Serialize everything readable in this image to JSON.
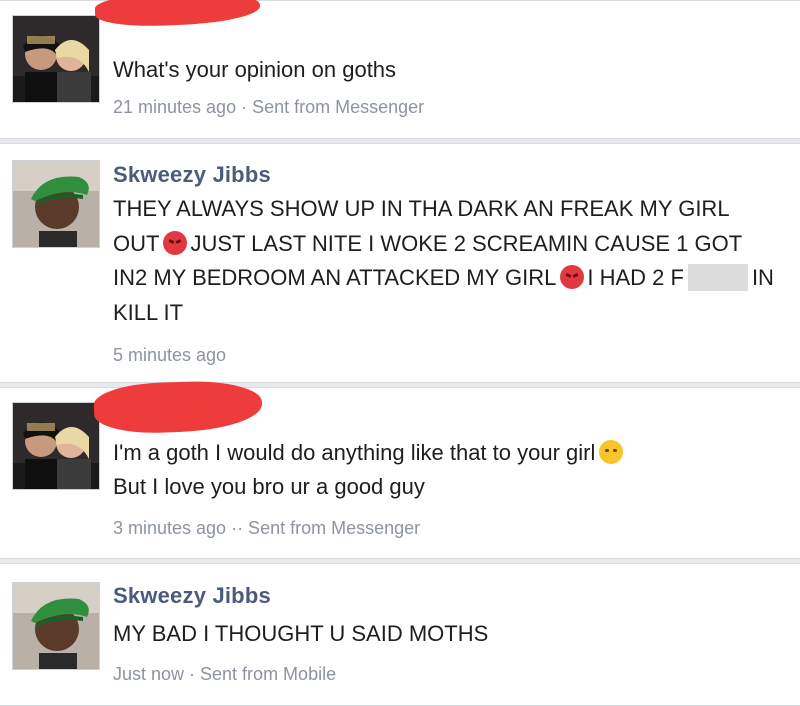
{
  "comments": [
    {
      "author": "",
      "avatar": "couple-selfie-avatar",
      "text": "What's your opinion on goths",
      "meta": "21 minutes ago · Sent from Messenger"
    },
    {
      "author": "Skweezy Jibbs",
      "avatar": "cap-man-avatar",
      "text_parts": [
        "THEY ALWAYS SHOW UP IN THA DARK AN FREAK MY GIRL OUT",
        "JUST LAST NITE I WOKE 2 SCREAMIN CAUSE 1 GOT IN2 MY BEDROOM AN ATTACKED MY GIRL",
        "I HAD 2 F",
        "IN KILL IT"
      ],
      "emojis": [
        "angry-face-emoji",
        "angry-face-emoji"
      ],
      "meta": "5 minutes ago"
    },
    {
      "author": "",
      "avatar": "couple-selfie-avatar",
      "text_parts": [
        "I'm a goth I would do anything like that to your girl",
        "But I love you bro ur a good guy"
      ],
      "emoji": "sad-face-emoji",
      "meta": "3 minutes ago ·· Sent from Messenger"
    },
    {
      "author": "Skweezy Jibbs",
      "avatar": "cap-man-avatar",
      "text": "MY BAD I THOUGHT U SAID MOTHS",
      "meta": "Just now · Sent from Mobile"
    }
  ],
  "colors": {
    "author_name": "#4b5b7c",
    "meta_text": "#8d949e",
    "redaction": "#ee3b3b",
    "background": "#e9eaee"
  }
}
